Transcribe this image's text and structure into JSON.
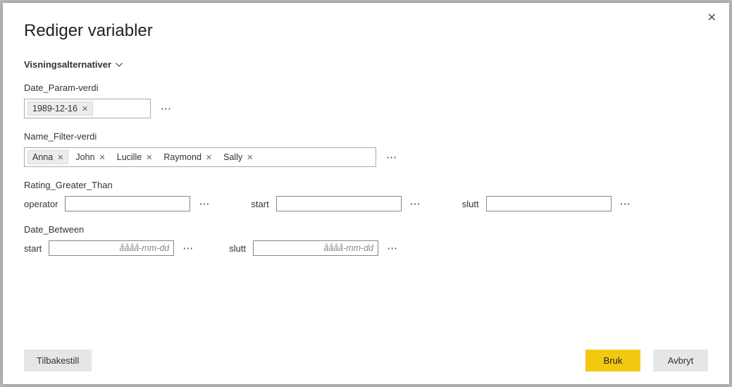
{
  "title": "Rediger variabler",
  "display_options_label": "Visningsalternativer",
  "close_icon_glyph": "✕",
  "ellipsis_glyph": "⋯",
  "chip_close_glyph": "✕",
  "variables": {
    "date_param": {
      "label": "Date_Param-verdi",
      "chip": "1989-12-16"
    },
    "name_filter": {
      "label": "Name_Filter-verdi",
      "chips": [
        "Anna",
        "John",
        "Lucille",
        "Raymond",
        "Sally"
      ]
    },
    "rating_greater_than": {
      "label": "Rating_Greater_Than",
      "operator_label": "operator",
      "start_label": "start",
      "slutt_label": "slutt"
    },
    "date_between": {
      "label": "Date_Between",
      "start_label": "start",
      "slutt_label": "slutt",
      "placeholder": "åååå-mm-dd"
    }
  },
  "buttons": {
    "reset": "Tilbakestill",
    "apply": "Bruk",
    "cancel": "Avbryt"
  }
}
